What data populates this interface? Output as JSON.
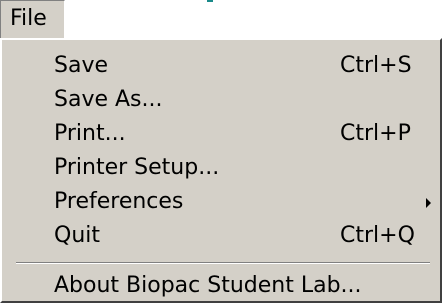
{
  "menubar": {
    "file_label": "File"
  },
  "menu": {
    "items": [
      {
        "label": "Save",
        "shortcut": "Ctrl+S"
      },
      {
        "label": "Save As...",
        "shortcut": ""
      },
      {
        "label": "Print...",
        "shortcut": "Ctrl+P"
      },
      {
        "label": "Printer Setup...",
        "shortcut": ""
      },
      {
        "label": "Preferences",
        "shortcut": "",
        "submenu_icon": "chevron-right-icon"
      },
      {
        "label": "Quit",
        "shortcut": "Ctrl+Q"
      }
    ],
    "about_label": "About Biopac Student Lab..."
  },
  "colors": {
    "menu_background": "#d4d0c8",
    "accent_teal": "#1a8a8a"
  }
}
